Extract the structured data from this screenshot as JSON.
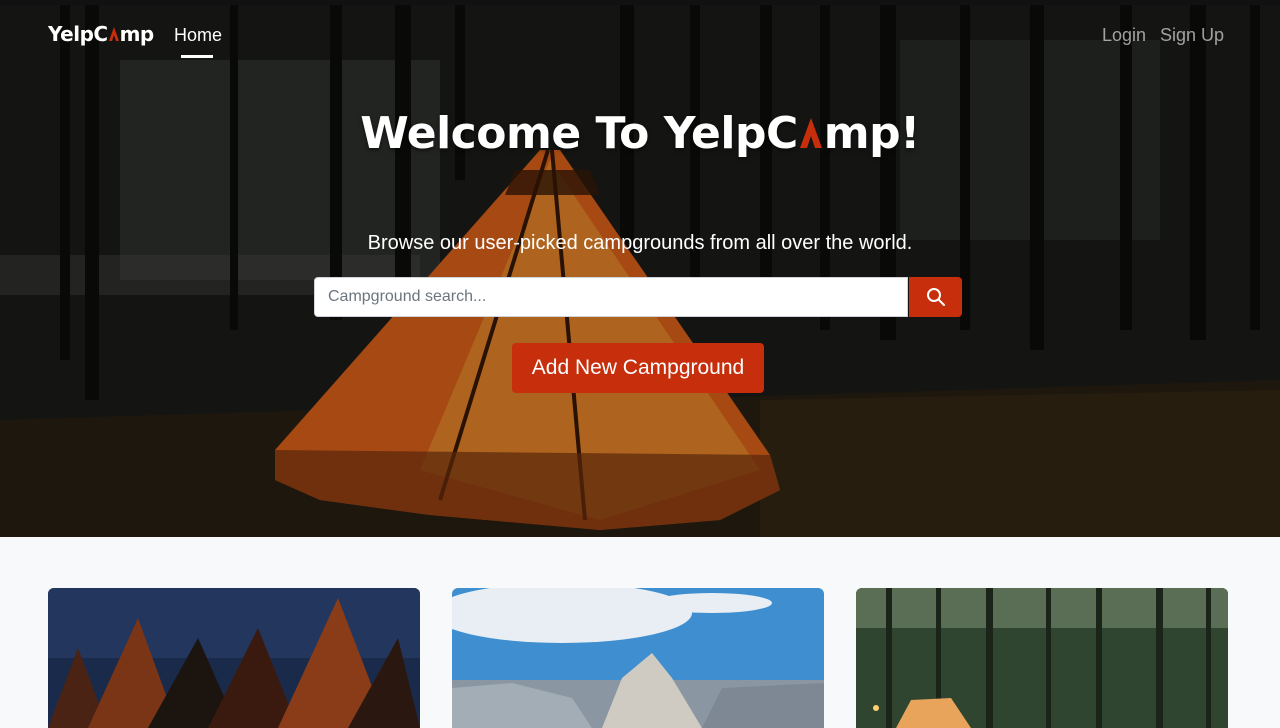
{
  "nav": {
    "brand_prefix": "YelpC",
    "brand_suffix": "mp",
    "home_label": "Home",
    "login_label": "Login",
    "signup_label": "Sign Up"
  },
  "hero": {
    "title_prefix": "Welcome To YelpC",
    "title_suffix": "mp!",
    "subtitle": "Browse our user-picked campgrounds from all over the world.",
    "search_placeholder": "Campground search...",
    "search_icon": "search-icon",
    "add_button_label": "Add New Campground",
    "background_image": "teepee-tent-forest-night"
  },
  "cards": [
    {
      "image": "forest-night-sky-trees"
    },
    {
      "image": "mountain-rock-summit"
    },
    {
      "image": "forest-camping-tent"
    }
  ],
  "colors": {
    "accent": "#c72e0c",
    "page_bg": "#f8f9fa"
  }
}
